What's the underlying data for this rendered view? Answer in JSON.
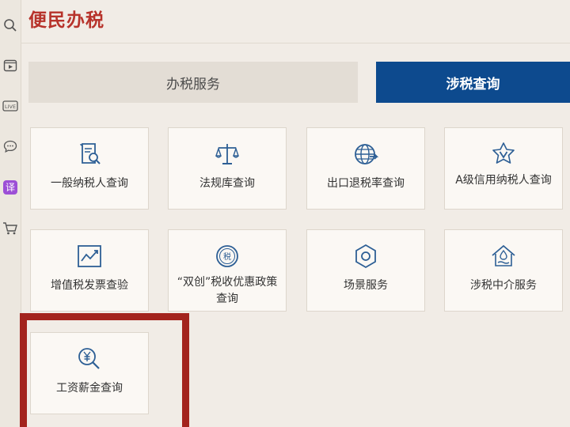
{
  "header": {
    "title": "便民办税"
  },
  "tabs": [
    {
      "label": "办税服务"
    },
    {
      "label": "涉税查询"
    }
  ],
  "cards": [
    {
      "label": "一般纳税人查询",
      "icon": "document-search-icon"
    },
    {
      "label": "法规库查询",
      "icon": "scales-icon"
    },
    {
      "label": "出口退税率查询",
      "icon": "globe-export-icon"
    },
    {
      "label": "A级信用纳税人查询",
      "icon": "badge-v-icon"
    },
    {
      "label": "增值税发票查验",
      "icon": "chart-trend-icon"
    },
    {
      "label": "“双创”税收优惠政策查询",
      "icon": "tax-seal-icon"
    },
    {
      "label": "场景服务",
      "icon": "hexagon-icon"
    },
    {
      "label": "涉税中介服务",
      "icon": "house-water-icon"
    },
    {
      "label": "工资薪金查询",
      "icon": "yen-search-icon"
    }
  ],
  "sidebar": {
    "translate_label": "译",
    "icons": [
      "search-icon",
      "video-icon",
      "live-icon",
      "chat-icon",
      "translate-icon",
      "cart-icon"
    ]
  },
  "colors": {
    "title": "#b7332b",
    "active_tab": "#0d4a8e",
    "highlight": "#a3231d",
    "icon": "#2d5f95"
  }
}
